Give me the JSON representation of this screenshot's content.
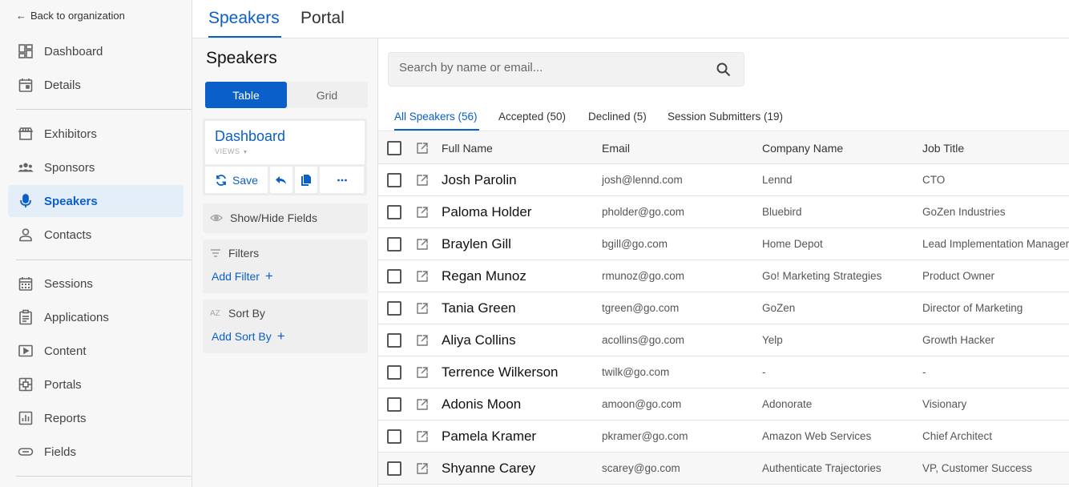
{
  "nav": {
    "back_label": "Back to organization",
    "items": [
      {
        "label": "Dashboard",
        "icon": "dashboard-icon"
      },
      {
        "label": "Details",
        "icon": "calendar-icon"
      },
      {
        "label": "Exhibitors",
        "icon": "storefront-icon"
      },
      {
        "label": "Sponsors",
        "icon": "group-icon"
      },
      {
        "label": "Speakers",
        "icon": "microphone-icon"
      },
      {
        "label": "Contacts",
        "icon": "person-icon"
      },
      {
        "label": "Sessions",
        "icon": "calendar-grid-icon"
      },
      {
        "label": "Applications",
        "icon": "clipboard-icon"
      },
      {
        "label": "Content",
        "icon": "play-screen-icon"
      },
      {
        "label": "Portals",
        "icon": "portal-grid-icon"
      },
      {
        "label": "Reports",
        "icon": "bar-chart-icon"
      },
      {
        "label": "Fields",
        "icon": "toggle-icon"
      }
    ],
    "active": "Speakers"
  },
  "top_tabs": [
    {
      "label": "Speakers",
      "active": true
    },
    {
      "label": "Portal",
      "active": false
    }
  ],
  "views_panel": {
    "title": "Speakers",
    "toggle": {
      "table_label": "Table",
      "grid_label": "Grid",
      "selected": "Table"
    },
    "current_view": {
      "name": "Dashboard",
      "sub": "VIEWS"
    },
    "save_label": "Save",
    "show_hide_label": "Show/Hide Fields",
    "filters_label": "Filters",
    "add_filter_label": "Add Filter",
    "sort_label": "Sort By",
    "sort_icon_text": "AZ",
    "add_sort_label": "Add Sort By"
  },
  "search": {
    "placeholder": "Search by name or email...",
    "value": ""
  },
  "list_tabs": [
    {
      "label": "All Speakers (56)",
      "active": true
    },
    {
      "label": "Accepted (50)",
      "active": false
    },
    {
      "label": "Declined (5)",
      "active": false
    },
    {
      "label": "Session Submitters (19)",
      "active": false
    }
  ],
  "table": {
    "columns": [
      "Full Name",
      "Email",
      "Company Name",
      "Job Title"
    ],
    "rows": [
      {
        "name": "Josh Parolin",
        "email": "josh@lennd.com",
        "company": "Lennd",
        "job": "CTO"
      },
      {
        "name": "Paloma Holder",
        "email": "pholder@go.com",
        "company": "Bluebird",
        "job": "GoZen Industries"
      },
      {
        "name": "Braylen Gill",
        "email": "bgill@go.com",
        "company": "Home Depot",
        "job": "Lead Implementation Manager"
      },
      {
        "name": "Regan Munoz",
        "email": "rmunoz@go.com",
        "company": "Go! Marketing Strategies",
        "job": "Product Owner"
      },
      {
        "name": "Tania Green",
        "email": "tgreen@go.com",
        "company": "GoZen",
        "job": "Director of Marketing"
      },
      {
        "name": "Aliya Collins",
        "email": "acollins@go.com",
        "company": "Yelp",
        "job": "Growth Hacker"
      },
      {
        "name": "Terrence Wilkerson",
        "email": "twilk@go.com",
        "company": "-",
        "job": "-"
      },
      {
        "name": "Adonis Moon",
        "email": "amoon@go.com",
        "company": "Adonorate",
        "job": "Visionary"
      },
      {
        "name": "Pamela Kramer",
        "email": "pkramer@go.com",
        "company": "Amazon Web Services",
        "job": "Chief Architect"
      },
      {
        "name": "Shyanne Carey",
        "email": "scarey@go.com",
        "company": "Authenticate Trajectories",
        "job": "VP, Customer Success"
      }
    ]
  },
  "colors": {
    "accent": "#0a5fc9",
    "active_nav_bg": "#e4eef9"
  }
}
